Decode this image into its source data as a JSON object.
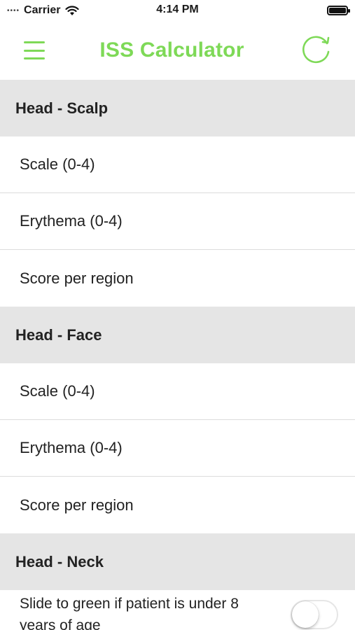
{
  "status_bar": {
    "signal": "••••",
    "carrier": "Carrier",
    "time": "4:14 PM"
  },
  "nav": {
    "title": "ISS Calculator",
    "accent_color": "#7ed957",
    "menu_icon": "hamburger-menu-icon",
    "refresh_icon": "refresh-icon"
  },
  "sections": [
    {
      "header": "Head - Scalp",
      "rows": [
        {
          "placeholder": "Scale (0-4)"
        },
        {
          "placeholder": "Erythema (0-4)"
        },
        {
          "placeholder": "Score per region"
        }
      ]
    },
    {
      "header": "Head - Face",
      "rows": [
        {
          "placeholder": "Scale (0-4)"
        },
        {
          "placeholder": "Erythema (0-4)"
        },
        {
          "placeholder": "Score per region"
        }
      ]
    },
    {
      "header": "Head - Neck",
      "toggle": {
        "label": "Slide to green if patient is under 8 years of age",
        "on": false
      }
    }
  ]
}
